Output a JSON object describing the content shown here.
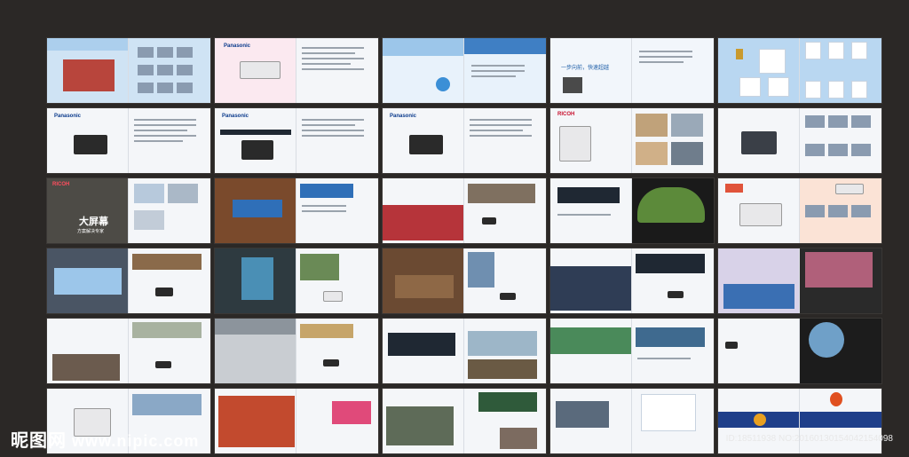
{
  "watermark": {
    "logo": "昵图网",
    "url": "www.nipic.com"
  },
  "id_line": "ID:18511938 NO:20160130154042154098",
  "brands": {
    "panasonic": "Panasonic",
    "ricoh": "RICOH"
  },
  "slogans": {
    "step": "一步向前，快速超越"
  },
  "headings": {
    "big_screen": "大屏幕",
    "big_screen_sub": "方案解决专家"
  },
  "colors": {
    "background": "#2b2826",
    "accent_blue": "#2f6fb8",
    "ricoh_red": "#c8102e"
  }
}
